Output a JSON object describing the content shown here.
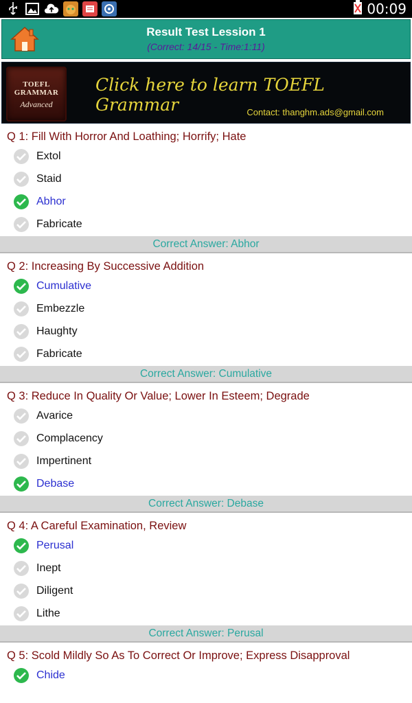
{
  "status_bar": {
    "time": "00:09",
    "icons": [
      "usb-icon",
      "image-icon",
      "cloud-upload-icon",
      "cat-app-icon",
      "news-app-icon",
      "gear-app-icon",
      "battery-icon"
    ]
  },
  "header": {
    "title": "Result Test Lession 1",
    "subtitle": "(Correct: 14/15 -  Time:1:11)"
  },
  "banner": {
    "logo_line1": "TOEFL GRAMMAR",
    "logo_line2": "Advanced",
    "cta": "Click here to learn TOEFL Grammar",
    "contact": "Contact: thanghm.ads@gmail.com"
  },
  "questions": [
    {
      "title": "Q 1: Fill With Horror And Loathing; Horrify; Hate",
      "choices": [
        "Extol",
        "Staid",
        "Abhor",
        "Fabricate"
      ],
      "correct_index": 2,
      "answer": "Correct Answer: Abhor"
    },
    {
      "title": "Q 2: Increasing By Successive Addition",
      "choices": [
        "Cumulative",
        "Embezzle",
        "Haughty",
        "Fabricate"
      ],
      "correct_index": 0,
      "answer": "Correct Answer: Cumulative"
    },
    {
      "title": "Q 3: Reduce In Quality Or Value; Lower In Esteem; Degrade",
      "choices": [
        "Avarice",
        "Complacency",
        "Impertinent",
        "Debase"
      ],
      "correct_index": 3,
      "answer": "Correct Answer: Debase"
    },
    {
      "title": "Q 4: A Careful Examination, Review",
      "choices": [
        "Perusal",
        "Inept",
        "Diligent",
        "Lithe"
      ],
      "correct_index": 0,
      "answer": "Correct Answer: Perusal"
    },
    {
      "title": "Q 5: Scold Mildly So As To Correct Or Improve; Express Disapproval",
      "choices": [
        "Chide"
      ],
      "correct_index": 0,
      "answer": ""
    }
  ],
  "colors": {
    "header_bg": "#1f9c85",
    "subtitle": "#5a1a9a",
    "question_title": "#7a1010",
    "correct_choice": "#2b2fd0",
    "answer_text": "#2aa8a0",
    "check_correct": "#2db84d",
    "check_neutral": "#d9d9d9"
  }
}
